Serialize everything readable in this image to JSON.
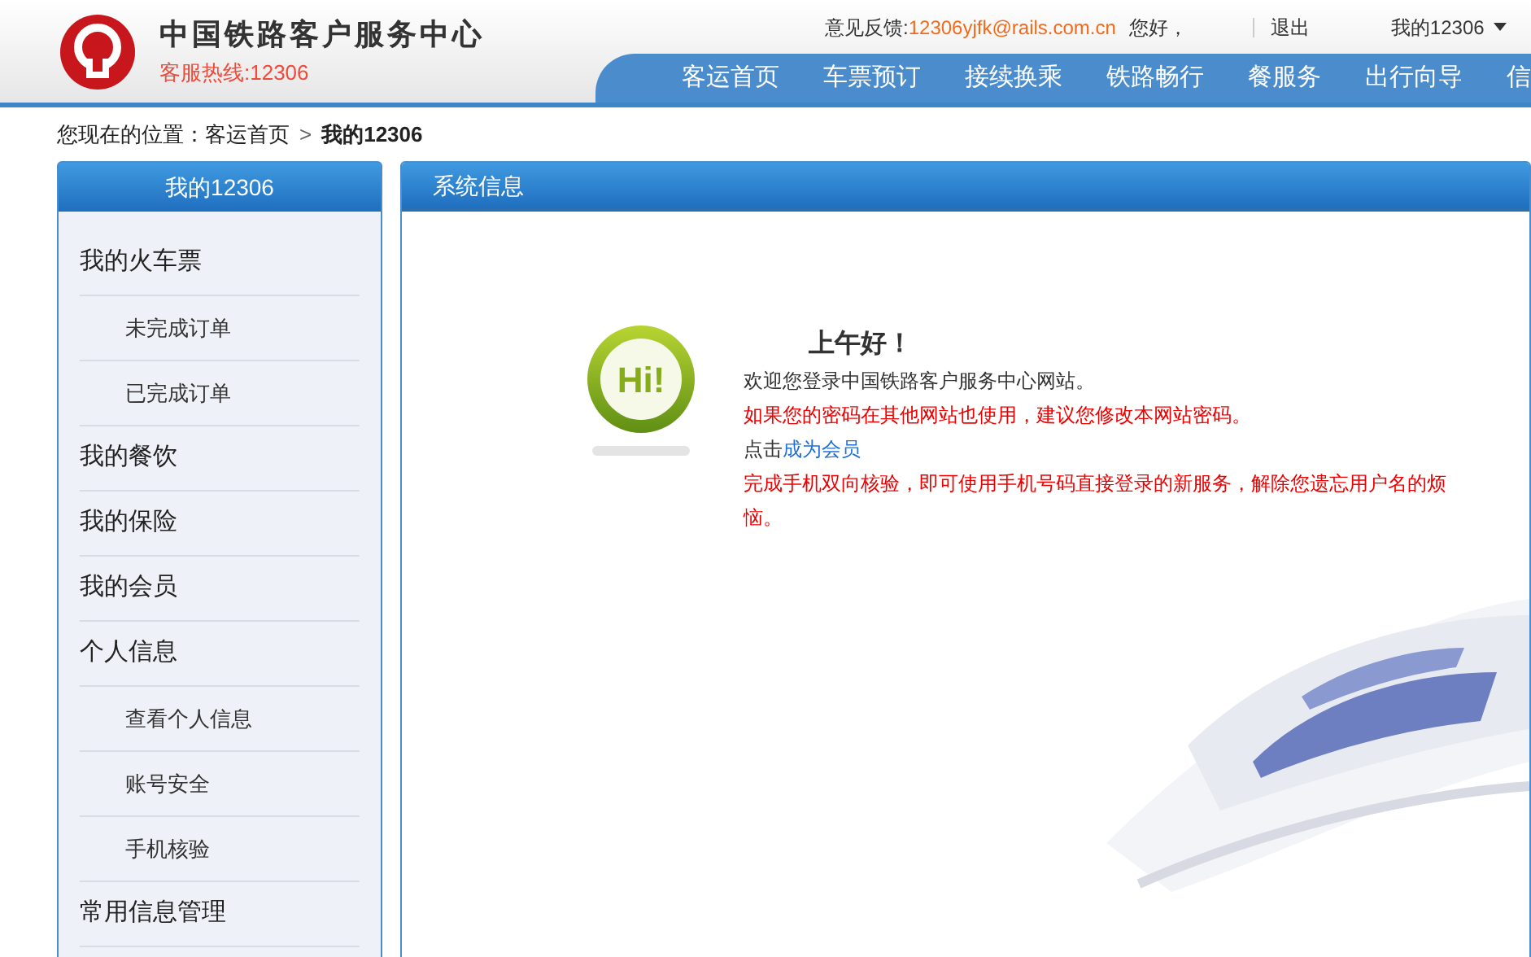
{
  "header": {
    "logo_title": "中国铁路客户服务中心",
    "hotline": "客服热线:12306",
    "feedback_label": "意见反馈:",
    "feedback_email": "12306yjfk@rails.com.cn",
    "greeting": "您好，",
    "logout": "退出",
    "my_menu": "我的12306"
  },
  "nav": [
    {
      "label": "客运首页"
    },
    {
      "label": "车票预订"
    },
    {
      "label": "接续换乘"
    },
    {
      "label": "铁路畅行"
    },
    {
      "label": "餐服务"
    },
    {
      "label": "出行向导"
    },
    {
      "label": "信"
    }
  ],
  "breadcrumb": {
    "label": "您现在的位置：",
    "items": [
      {
        "label": "客运首页",
        "selected": false
      },
      {
        "label": "我的12306",
        "selected": true
      }
    ],
    "separator": ">"
  },
  "sidebar": {
    "title": "我的12306",
    "items": [
      {
        "label": "我的火车票",
        "kind": "top"
      },
      {
        "label": "未完成订单",
        "kind": "sub"
      },
      {
        "label": "已完成订单",
        "kind": "sub"
      },
      {
        "label": "我的餐饮",
        "kind": "top"
      },
      {
        "label": "我的保险",
        "kind": "top"
      },
      {
        "label": "我的会员",
        "kind": "top"
      },
      {
        "label": "个人信息",
        "kind": "top"
      },
      {
        "label": "查看个人信息",
        "kind": "sub"
      },
      {
        "label": "账号安全",
        "kind": "sub"
      },
      {
        "label": "手机核验",
        "kind": "sub"
      },
      {
        "label": "常用信息管理",
        "kind": "top"
      }
    ]
  },
  "panel": {
    "title": "系统信息",
    "badge": "Hi!",
    "greeting": "上午好！",
    "lines": [
      {
        "kind": "plain",
        "text": "欢迎您登录中国铁路客户服务中心网站。"
      },
      {
        "kind": "warning",
        "text": "如果您的密码在其他网站也使用，建议您修改本网站密码。"
      },
      {
        "kind": "link",
        "text": "点击",
        "link": "成为会员"
      },
      {
        "kind": "warning",
        "text": "完成手机双向核验，即可使用手机号码直接登录的新服务，解除您遗忘用户名的烦恼。"
      }
    ]
  }
}
